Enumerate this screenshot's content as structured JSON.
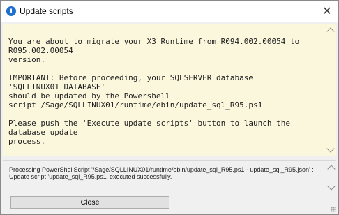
{
  "window": {
    "title": "Update scripts"
  },
  "message": {
    "line1": "You are about to migrate your X3 Runtime from R094.002.00054 to R095.002.00054",
    "line2": "version.",
    "line3": "IMPORTANT: Before proceeding, your SQLSERVER database 'SQLLINUX01_DATABASE'",
    "line4": "should be updated by the Powershell",
    "line5": "script /Sage/SQLLINUX01/runtime/ebin/update_sql_R95.ps1",
    "line6": "Please push the 'Execute update scripts' button to launch the database update",
    "line7": "process."
  },
  "log": {
    "line1": "Processing PowerShellScript '/Sage/SQLLINUX01/runtime/ebin/update_sql_R95.ps1 - update_sql_R95.json' :",
    "line2": "Update script 'update_sql_R95.ps1' executed successfully."
  },
  "buttons": {
    "close_label": "Close"
  },
  "colors": {
    "message_background": "#fbf7dd",
    "info_icon": "#1f6fd1"
  }
}
